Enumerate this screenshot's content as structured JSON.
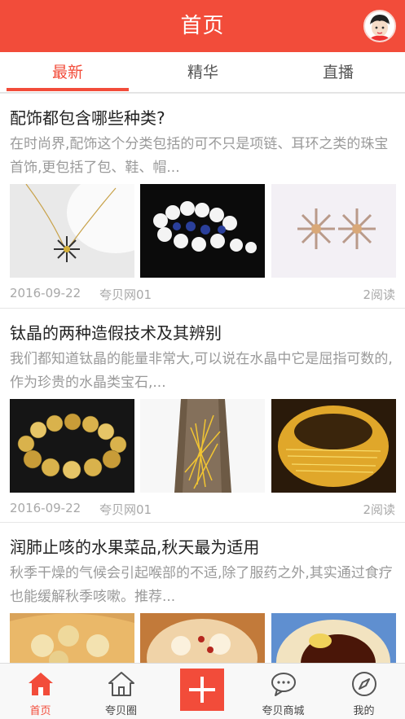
{
  "header": {
    "title": "首页"
  },
  "tabs": [
    {
      "label": "最新",
      "active": true
    },
    {
      "label": "精华",
      "active": false
    },
    {
      "label": "直播",
      "active": false
    }
  ],
  "articles": [
    {
      "title": "配饰都包含哪些种类?",
      "summary": "在时尚界,配饰这个分类包括的可不只是项链、耳环之类的珠宝首饰,更包括了包、鞋、帽...",
      "date": "2016-09-22",
      "source": "夸贝网01",
      "reads": "2阅读",
      "images": [
        "necklace-pendant-image",
        "pearl-bracelet-image",
        "earring-image"
      ]
    },
    {
      "title": "钛晶的两种造假技术及其辨别",
      "summary": "我们都知道钛晶的能量非常大,可以说在水晶中它是屈指可数的,作为珍贵的水晶类宝石,...",
      "date": "2016-09-22",
      "source": "夸贝网01",
      "reads": "2阅读",
      "images": [
        "crystal-bracelet-image",
        "rutile-crystal-image",
        "crystal-ring-image"
      ]
    },
    {
      "title": "润肺止咳的水果菜品,秋天最为适用",
      "summary": "秋季干燥的气候会引起喉部的不适,除了服药之外,其实通过食疗也能缓解秋季咳嗽。推荐...",
      "date": "",
      "source": "",
      "reads": "",
      "images": [
        "fruit-tart-image",
        "pear-soup-image",
        "dessert-bowl-image"
      ]
    }
  ],
  "bottom_nav": [
    {
      "label": "首页",
      "icon": "home-icon",
      "active": true
    },
    {
      "label": "夸贝圈",
      "icon": "house-outline-icon",
      "active": false
    },
    {
      "label": "",
      "icon": "plus-icon",
      "active": false
    },
    {
      "label": "夸贝商城",
      "icon": "chat-bubble-icon",
      "active": false
    },
    {
      "label": "我的",
      "icon": "compass-icon",
      "active": false
    }
  ],
  "colors": {
    "accent": "#f24c3a",
    "text": "#222222",
    "muted": "#9a9a9a"
  }
}
